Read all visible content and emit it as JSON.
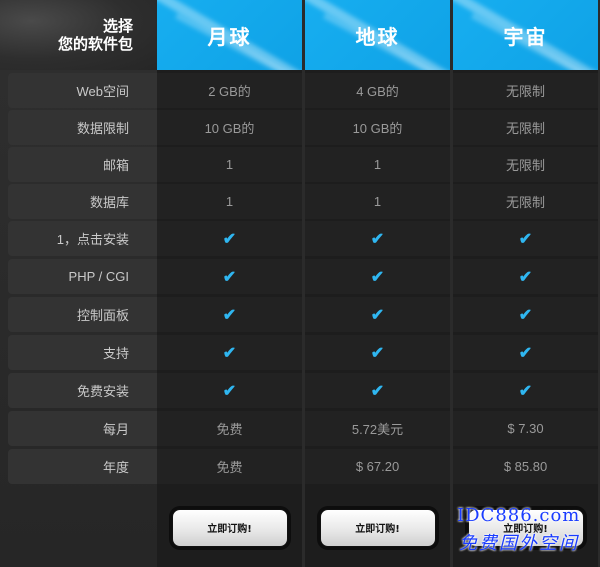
{
  "header": {
    "title_line1": "选择",
    "title_line2": "您的软件包"
  },
  "plans": [
    {
      "name": "月球",
      "button_label": "立即订购!"
    },
    {
      "name": "地球",
      "button_label": "立即订购!"
    },
    {
      "name": "宇宙",
      "button_label": "立即订购!"
    }
  ],
  "rows": [
    {
      "label": "Web空间",
      "values": [
        "2 GB的",
        "4 GB的",
        "无限制"
      ]
    },
    {
      "label": "数据限制",
      "values": [
        "10 GB的",
        "10 GB的",
        "无限制"
      ]
    },
    {
      "label": "邮箱",
      "values": [
        "1",
        "1",
        "无限制"
      ]
    },
    {
      "label": "数据库",
      "values": [
        "1",
        "1",
        "无限制"
      ]
    },
    {
      "label": "1，点击安装",
      "values": [
        "✔",
        "✔",
        "✔"
      ]
    },
    {
      "label": "PHP / CGI",
      "values": [
        "✔",
        "✔",
        "✔"
      ]
    },
    {
      "label": "控制面板",
      "values": [
        "✔",
        "✔",
        "✔"
      ]
    },
    {
      "label": "支持",
      "values": [
        "✔",
        "✔",
        "✔"
      ]
    },
    {
      "label": "免费安装",
      "values": [
        "✔",
        "✔",
        "✔"
      ]
    },
    {
      "label": "每月",
      "values": [
        "免费",
        "5.72美元",
        "$ 7.30"
      ]
    },
    {
      "label": "年度",
      "values": [
        "免费",
        "$ 67.20",
        "$ 85.80"
      ]
    }
  ],
  "watermark": {
    "line1": "IDC886.com",
    "line2": "免费国外空间"
  },
  "colors": {
    "accent": "#17aef0",
    "check": "#2fb6f0",
    "background": "#2b2b2b"
  }
}
